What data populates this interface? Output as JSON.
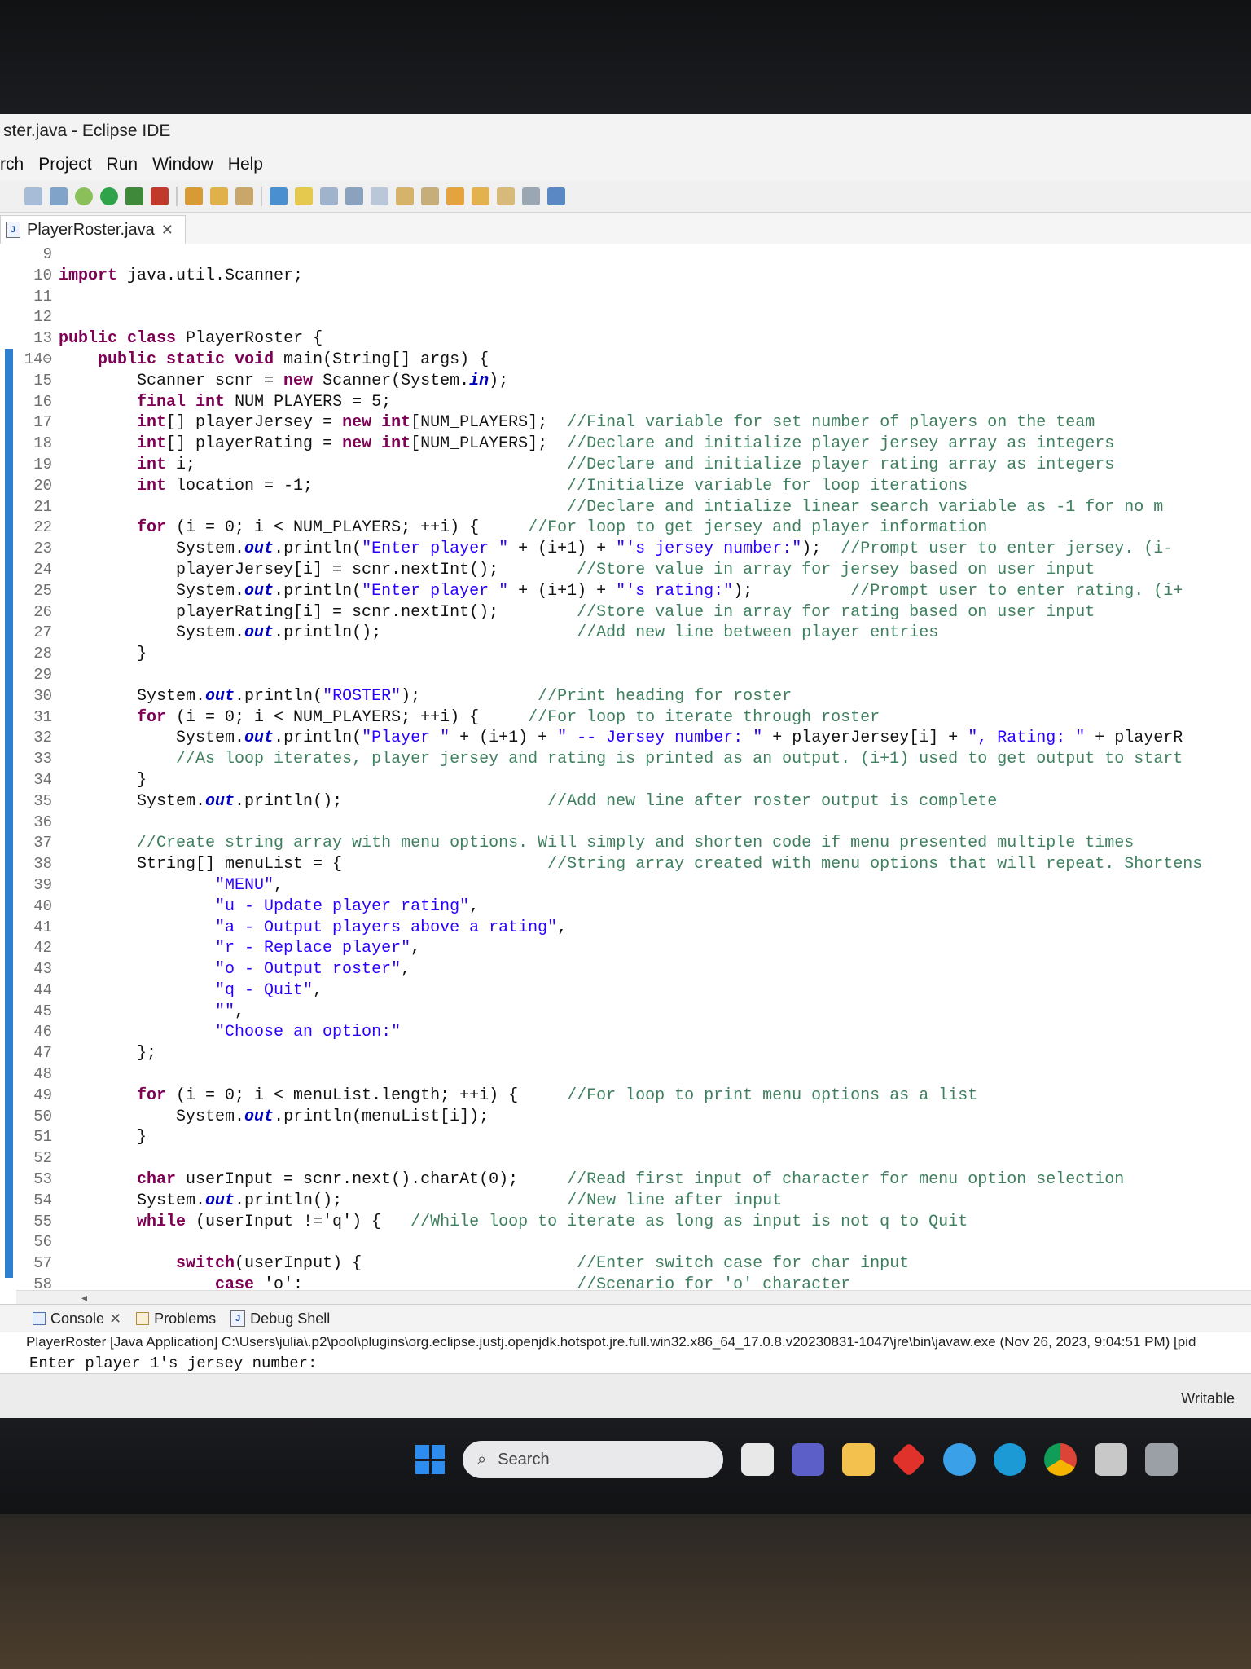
{
  "window": {
    "title": "ster.java - Eclipse IDE"
  },
  "menu": [
    "rch",
    "Project",
    "Run",
    "Window",
    "Help"
  ],
  "editor_tab": {
    "label": "PlayerRoster.java"
  },
  "code_lines": [
    {
      "n": "9",
      "t": ""
    },
    {
      "n": "10",
      "t": "import java.util.Scanner;"
    },
    {
      "n": "11",
      "t": ""
    },
    {
      "n": "12",
      "t": ""
    },
    {
      "n": "13",
      "t": "public class PlayerRoster {"
    },
    {
      "n": "14⊖",
      "t": "    public static void main(String[] args) {"
    },
    {
      "n": "15",
      "t": "        Scanner scnr = new Scanner(System.in);"
    },
    {
      "n": "16",
      "t": "        final int NUM_PLAYERS = 5;"
    },
    {
      "n": "17",
      "t": "        int[] playerJersey = new int[NUM_PLAYERS];  //Final variable for set number of players on the team"
    },
    {
      "n": "18",
      "t": "        int[] playerRating = new int[NUM_PLAYERS];  //Declare and initialize player jersey array as integers"
    },
    {
      "n": "19",
      "t": "        int i;                                      //Declare and initialize player rating array as integers"
    },
    {
      "n": "20",
      "t": "        int location = -1;                          //Initialize variable for loop iterations"
    },
    {
      "n": "21",
      "t": "                                                    //Declare and intialize linear search variable as -1 for no m"
    },
    {
      "n": "22",
      "t": "        for (i = 0; i < NUM_PLAYERS; ++i) {     //For loop to get jersey and player information"
    },
    {
      "n": "23",
      "t": "            System.out.println(\"Enter player \" + (i+1) + \"'s jersey number:\");  //Prompt user to enter jersey. (i-"
    },
    {
      "n": "24",
      "t": "            playerJersey[i] = scnr.nextInt();        //Store value in array for jersey based on user input"
    },
    {
      "n": "25",
      "t": "            System.out.println(\"Enter player \" + (i+1) + \"'s rating:\");          //Prompt user to enter rating. (i+"
    },
    {
      "n": "26",
      "t": "            playerRating[i] = scnr.nextInt();        //Store value in array for rating based on user input"
    },
    {
      "n": "27",
      "t": "            System.out.println();                    //Add new line between player entries"
    },
    {
      "n": "28",
      "t": "        }"
    },
    {
      "n": "29",
      "t": ""
    },
    {
      "n": "30",
      "t": "        System.out.println(\"ROSTER\");            //Print heading for roster"
    },
    {
      "n": "31",
      "t": "        for (i = 0; i < NUM_PLAYERS; ++i) {     //For loop to iterate through roster"
    },
    {
      "n": "32",
      "t": "            System.out.println(\"Player \" + (i+1) + \" -- Jersey number: \" + playerJersey[i] + \", Rating: \" + playerR"
    },
    {
      "n": "33",
      "t": "            //As loop iterates, player jersey and rating is printed as an output. (i+1) used to get output to start"
    },
    {
      "n": "34",
      "t": "        }"
    },
    {
      "n": "35",
      "t": "        System.out.println();                     //Add new line after roster output is complete"
    },
    {
      "n": "36",
      "t": ""
    },
    {
      "n": "37",
      "t": "        //Create string array with menu options. Will simply and shorten code if menu presented multiple times"
    },
    {
      "n": "38",
      "t": "        String[] menuList = {                     //String array created with menu options that will repeat. Shortens"
    },
    {
      "n": "39",
      "t": "                \"MENU\","
    },
    {
      "n": "40",
      "t": "                \"u - Update player rating\","
    },
    {
      "n": "41",
      "t": "                \"a - Output players above a rating\","
    },
    {
      "n": "42",
      "t": "                \"r - Replace player\","
    },
    {
      "n": "43",
      "t": "                \"o - Output roster\","
    },
    {
      "n": "44",
      "t": "                \"q - Quit\","
    },
    {
      "n": "45",
      "t": "                \"\","
    },
    {
      "n": "46",
      "t": "                \"Choose an option:\""
    },
    {
      "n": "47",
      "t": "        };"
    },
    {
      "n": "48",
      "t": ""
    },
    {
      "n": "49",
      "t": "        for (i = 0; i < menuList.length; ++i) {     //For loop to print menu options as a list"
    },
    {
      "n": "50",
      "t": "            System.out.println(menuList[i]);"
    },
    {
      "n": "51",
      "t": "        }"
    },
    {
      "n": "52",
      "t": ""
    },
    {
      "n": "53",
      "t": "        char userInput = scnr.next().charAt(0);     //Read first input of character for menu option selection"
    },
    {
      "n": "54",
      "t": "        System.out.println();                       //New line after input"
    },
    {
      "n": "55",
      "t": "        while (userInput !='q') {   //While loop to iterate as long as input is not q to Quit"
    },
    {
      "n": "56",
      "t": ""
    },
    {
      "n": "57",
      "t": "            switch(userInput) {                      //Enter switch case for char input"
    },
    {
      "n": "58",
      "t": "                case 'o':                            //Scenario for 'o' character"
    }
  ],
  "console": {
    "tabs": [
      "Console",
      "Problems",
      "Debug Shell"
    ],
    "description": "PlayerRoster [Java Application] C:\\Users\\julia\\.p2\\pool\\plugins\\org.eclipse.justj.openjdk.hotspot.jre.full.win32.x86_64_17.0.8.v20230831-1047\\jre\\bin\\javaw.exe  (Nov 26, 2023, 9:04:51 PM) [pid",
    "output": "Enter player 1's jersey number:"
  },
  "status": {
    "writable": "Writable"
  },
  "taskbar": {
    "search_placeholder": "Search"
  },
  "colors": {
    "keyword": "#7f0055",
    "comment": "#3f7f5f",
    "string": "#2a00ff",
    "change_bar": "#2f7fd1"
  }
}
